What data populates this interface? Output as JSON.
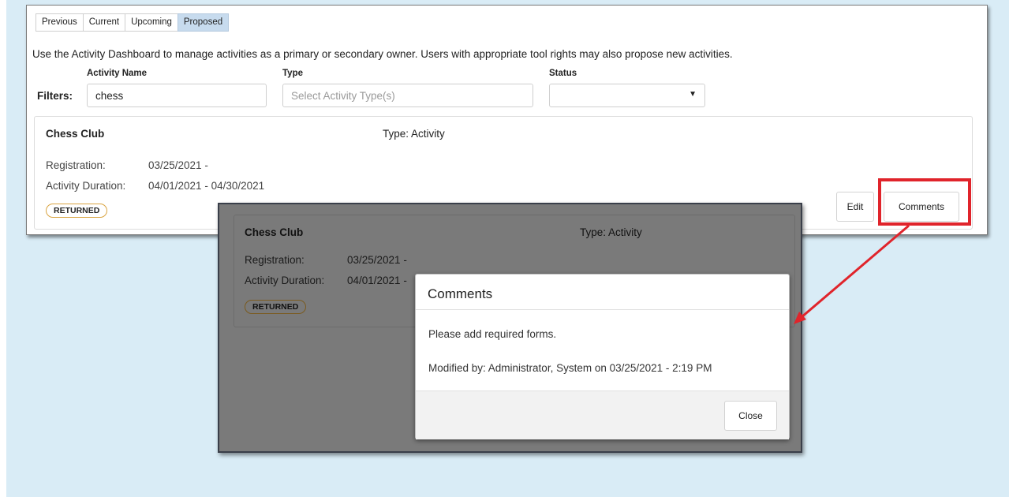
{
  "tabs": [
    {
      "label": "Previous",
      "active": false
    },
    {
      "label": "Current",
      "active": false
    },
    {
      "label": "Upcoming",
      "active": false
    },
    {
      "label": "Proposed",
      "active": true
    }
  ],
  "intro_text": "Use the Activity Dashboard to manage activities as a primary or secondary owner. Users with appropriate tool rights may also propose new activities.",
  "filters": {
    "label": "Filters:",
    "activity_name": {
      "label": "Activity Name",
      "value": "chess"
    },
    "type": {
      "label": "Type",
      "placeholder": "Select Activity Type(s)"
    },
    "status": {
      "label": "Status",
      "value": ""
    }
  },
  "activity": {
    "name": "Chess Club",
    "type": "Type: Activity",
    "registration_label": "Registration:",
    "registration_value": "03/25/2021 -",
    "duration_label": "Activity Duration:",
    "duration_value": "04/01/2021 - 04/30/2021",
    "duration_value_truncated": "04/01/2021 -",
    "status_badge": "RETURNED",
    "edit_label": "Edit",
    "comments_label": "Comments"
  },
  "comments_modal": {
    "title": "Comments",
    "comment": "Please add required forms.",
    "modified": "Modified by: Administrator, System on 03/25/2021 - 2:19 PM",
    "close_label": "Close"
  },
  "colors": {
    "highlight": "#e0242b",
    "page_background": "#d9ecf6",
    "active_tab": "#c7dbee",
    "badge_border": "#d9a441"
  }
}
